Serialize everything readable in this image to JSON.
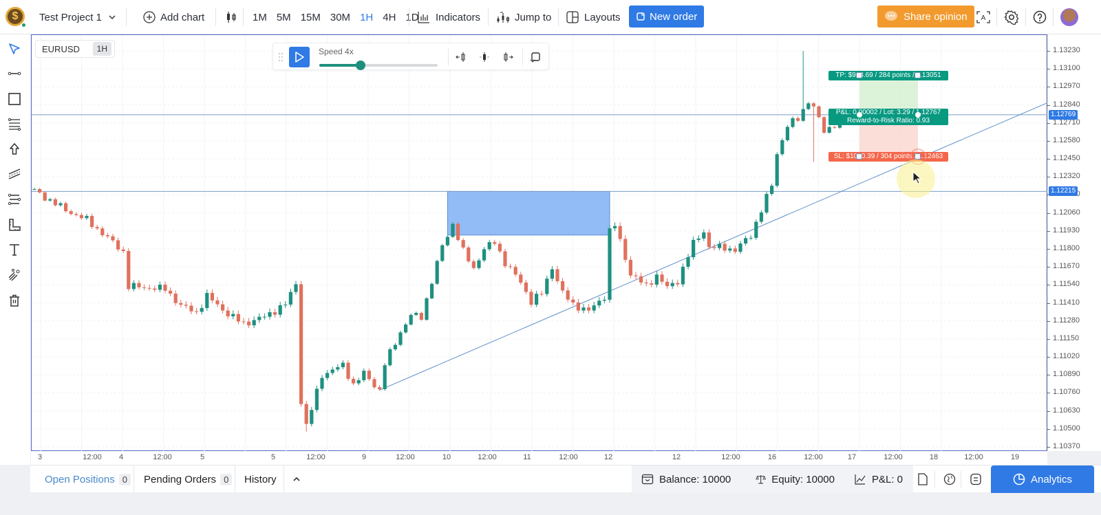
{
  "topbar": {
    "project_name": "Test Project 1",
    "add_chart_label": "Add chart",
    "timeframes": [
      {
        "label": "1M",
        "active": false
      },
      {
        "label": "5M",
        "active": false
      },
      {
        "label": "15M",
        "active": false
      },
      {
        "label": "30M",
        "active": false
      },
      {
        "label": "1H",
        "active": true
      },
      {
        "label": "4H",
        "active": false
      },
      {
        "label": "1D",
        "active": false
      }
    ],
    "indicators_label": "Indicators",
    "jump_to_label": "Jump to",
    "layouts_label": "Layouts",
    "new_order_label": "New order",
    "share_opinion_label": "Share opinion"
  },
  "colors": {
    "accent": "#2f7ae5",
    "bull": "#26a69a",
    "bear": "#ef5350",
    "share": "#f29a2e",
    "tp": "#089981",
    "sl": "#f4664a",
    "zone": "#7fb0f5"
  },
  "left_tools": [
    "cursor-icon",
    "trend-line-icon",
    "rectangle-icon",
    "fibonacci-icon",
    "arrow-up-icon",
    "channel-icon",
    "parallel-lines-icon",
    "ruler-icon",
    "text-icon",
    "magic-brush-icon",
    "trash-icon"
  ],
  "chart": {
    "symbol": "EURUSD",
    "timeframe": "1H",
    "replay": {
      "speed_label": "Speed 4x",
      "speed_progress": 0.35
    },
    "price_axis": {
      "max": 1.1323,
      "min": 1.1037,
      "ticks": [
        "1.13230",
        "1.13100",
        "1.12970",
        "1.12840",
        "1.12710",
        "1.12580",
        "1.12450",
        "1.12320",
        "1.12190",
        "1.12060",
        "1.11930",
        "1.11800",
        "1.11670",
        "1.11540",
        "1.11410",
        "1.11280",
        "1.11150",
        "1.11020",
        "1.10890",
        "1.10760",
        "1.10630",
        "1.10500",
        "1.10370"
      ]
    },
    "time_axis": [
      "3",
      "12:00",
      "4",
      "12:00",
      "5",
      "5",
      "12:00",
      "9",
      "12:00",
      "10",
      "12:00",
      "11",
      "12:00",
      "12",
      "12",
      "12:00",
      "16",
      "12:00",
      "17",
      "12:00",
      "18",
      "12:00",
      "19"
    ],
    "hlines": [
      {
        "price": 1.12769,
        "label": "1.12769"
      },
      {
        "price": 1.12215,
        "label": "1.12215"
      }
    ],
    "zone": {
      "from_index": 79,
      "to_index": 110,
      "top": 1.12215,
      "bottom": 1.119
    },
    "trendline": {
      "from_index": 66,
      "from_price": 1.1078,
      "to_index": 170,
      "to_price": 1.1247
    },
    "position": {
      "tp_label": "TP: $923.69 / 284 points / 1.13051",
      "pnl_label": "P&L: 0.00002 / Lot: 3.29 / 1.12767",
      "rr_label": "Reward-to-Risk Ratio: 0.93",
      "sl_label": "SL: $1000.39 / 304 points / 1.12463",
      "tp": 1.13051,
      "entry": 1.12767,
      "sl": 1.12463
    }
  },
  "chart_data": {
    "type": "candlestick",
    "title": "EURUSD 1H",
    "xlabel": "",
    "ylabel": "",
    "ylim": [
      1.1037,
      1.1323
    ],
    "candles": []
  },
  "bottombar": {
    "open_positions_label": "Open Positions",
    "open_positions_count": "0",
    "pending_orders_label": "Pending Orders",
    "pending_orders_count": "0",
    "history_label": "History",
    "balance": "Balance: 10000",
    "equity": "Equity: 10000",
    "pnl": "P&L: 0",
    "analytics_label": "Analytics"
  }
}
